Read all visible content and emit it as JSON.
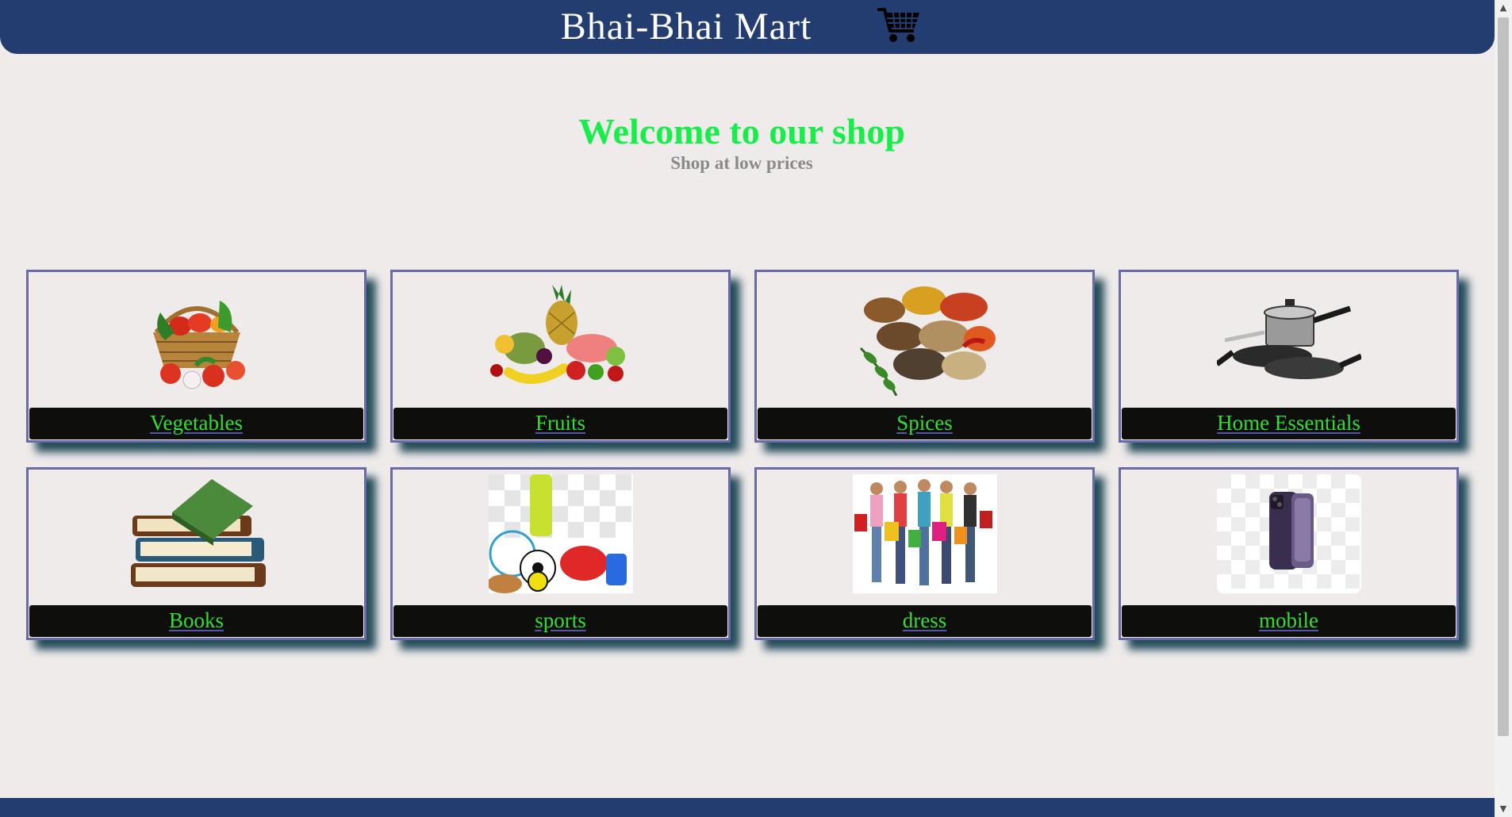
{
  "header": {
    "brand": "Bhai-Bhai Mart",
    "cart_icon": "shopping-cart-icon"
  },
  "hero": {
    "title": "Welcome to our shop",
    "subtitle": "Shop at low prices"
  },
  "categories": [
    {
      "label": "Vegetables",
      "icon": "vegetable-basket-image"
    },
    {
      "label": "Fruits",
      "icon": "fruit-assortment-image"
    },
    {
      "label": "Spices",
      "icon": "spices-image"
    },
    {
      "label": "Home Essentials",
      "icon": "cookware-image"
    },
    {
      "label": "Books",
      "icon": "book-stack-image"
    },
    {
      "label": "sports",
      "icon": "sports-equipment-image"
    },
    {
      "label": "dress",
      "icon": "shoppers-image"
    },
    {
      "label": "mobile",
      "icon": "smartphone-image"
    }
  ],
  "scrollbar": {
    "up_arrow": "▲",
    "down_arrow": "▼"
  },
  "colors": {
    "header": "#243d70",
    "accent_green": "#18ee4a",
    "card_border": "#6b6aa6",
    "label_bg": "#0e0e0c"
  }
}
